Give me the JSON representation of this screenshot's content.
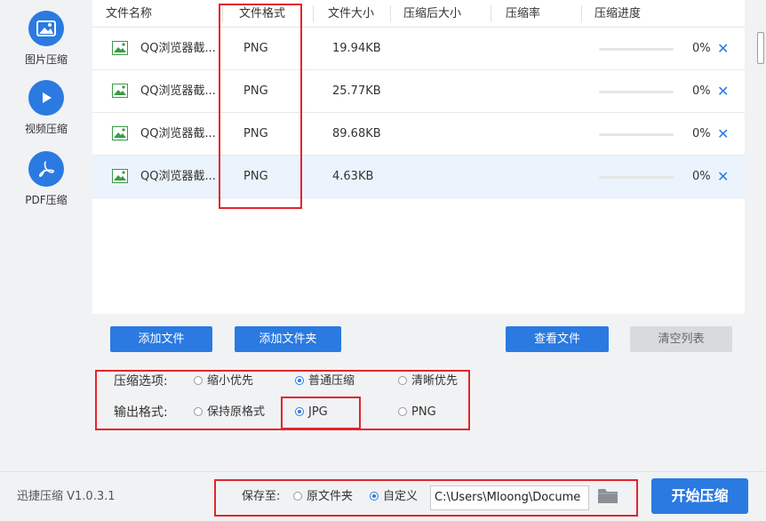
{
  "sidebar": {
    "items": [
      {
        "label": "图片压缩",
        "icon": "image-icon"
      },
      {
        "label": "视频压缩",
        "icon": "play-icon"
      },
      {
        "label": "PDF压缩",
        "icon": "pdf-icon"
      }
    ]
  },
  "table": {
    "headers": [
      "文件名称",
      "文件格式",
      "文件大小",
      "压缩后大小",
      "压缩率",
      "压缩进度"
    ],
    "rows": [
      {
        "name": "QQ浏览器截...",
        "format": "PNG",
        "size": "19.94KB",
        "compressed_size": "",
        "ratio": "",
        "progress": "0%"
      },
      {
        "name": "QQ浏览器截...",
        "format": "PNG",
        "size": "25.77KB",
        "compressed_size": "",
        "ratio": "",
        "progress": "0%"
      },
      {
        "name": "QQ浏览器截...",
        "format": "PNG",
        "size": "89.68KB",
        "compressed_size": "",
        "ratio": "",
        "progress": "0%"
      },
      {
        "name": "QQ浏览器截...",
        "format": "PNG",
        "size": "4.63KB",
        "compressed_size": "",
        "ratio": "",
        "progress": "0%"
      }
    ],
    "remove_symbol": "✕"
  },
  "buttons": {
    "add_file": "添加文件",
    "add_folder": "添加文件夹",
    "view_file": "查看文件",
    "clear_list": "清空列表"
  },
  "options": {
    "compress_label": "压缩选项:",
    "compress_choices": [
      {
        "label": "缩小优先",
        "selected": false
      },
      {
        "label": "普通压缩",
        "selected": true
      },
      {
        "label": "清晰优先",
        "selected": false
      }
    ],
    "format_label": "输出格式:",
    "format_choices": [
      {
        "label": "保持原格式",
        "selected": false
      },
      {
        "label": "JPG",
        "selected": true
      },
      {
        "label": "PNG",
        "selected": false
      }
    ]
  },
  "footer": {
    "version": "迅捷压缩 V1.0.3.1",
    "save_label": "保存至:",
    "save_choices": [
      {
        "label": "原文件夹",
        "selected": false
      },
      {
        "label": "自定义",
        "selected": true
      }
    ],
    "path_value": "C:\\Users\\Mloong\\Docume",
    "start_button": "开始压缩"
  },
  "colors": {
    "accent": "#2a7ae2",
    "highlight": "#e0262d",
    "selected_row": "#ebf4fd"
  }
}
